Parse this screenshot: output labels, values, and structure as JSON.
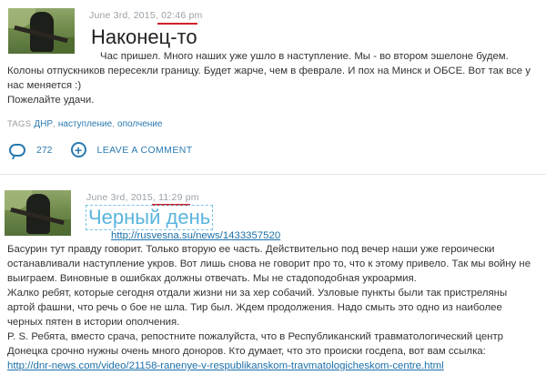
{
  "posts": [
    {
      "date": "June 3rd, 2015,",
      "time": "02:46 pm",
      "title": "Наконец-то",
      "lines": [
        "Час пришел. Много наших уже ушло в наступление. Мы - во втором эшелоне будем.",
        "Колоны отпускников пересекли границу. Будет жарче, чем в феврале. И пох на Минск и ОБСЕ. Вот так все у",
        "нас меняется :)",
        "Пожелайте удачи."
      ],
      "tags_label": "TAGS",
      "tags": [
        "ДНР",
        "наступление",
        "ополчение"
      ],
      "comments_count": "272",
      "leave_comment": "LEAVE A COMMENT"
    },
    {
      "date": "June 3rd, 2015,",
      "time": "11:29 pm",
      "title": "Черный день",
      "source_link": "http://rusvesna.su/news/1433357520",
      "lines": [
        "Басурин тут правду говорит. Только вторую ее часть. Действительно под вечер наши уже героически",
        "останавливали наступление укров. Вот лишь снова не говорит про то, что к этому привело. Так мы войну не",
        "выиграем. Виновные в ошибках должны отвечать. Мы не стадоподобная укроармия.",
        "Жалко ребят, которые сегодня отдали жизни ни за хер собачий. Узловые пункты были так пристреляны",
        "артой фашни, что речь о бое не шла. Тир был. Ждем продолжения. Надо смыть это одно из наиболее",
        "черных пятен в истории ополчения.",
        "P. S. Ребята, вместо срача, репостните пожалуйста, что в Республиканский травматологический центр",
        "Донецка срочно нужны очень много доноров. Кто думает, что это происки госдепа, вот вам ссылка:"
      ],
      "bottom_link": "http://dnr-news.com/video/21158-ranenye-v-respublikanskom-travmatologicheskom-centre.html"
    }
  ],
  "colors": {
    "accent_link": "#2a7ab0",
    "underline_red": "#d0212b",
    "meta_gray": "#9aa0a6"
  }
}
